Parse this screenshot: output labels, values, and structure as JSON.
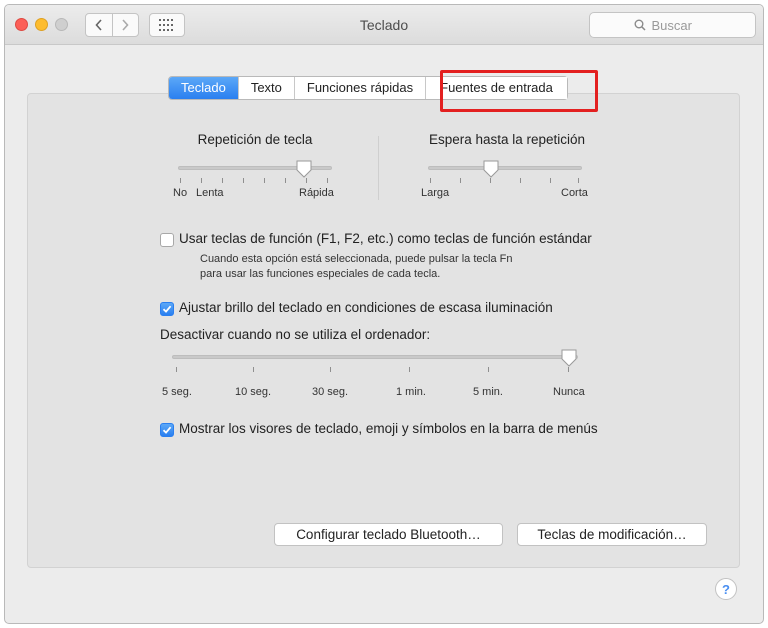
{
  "window": {
    "title": "Teclado",
    "search": {
      "placeholder": "Buscar",
      "value": ""
    }
  },
  "tabs": [
    {
      "label": "Teclado",
      "active": true
    },
    {
      "label": "Texto",
      "active": false
    },
    {
      "label": "Funciones rápidas",
      "active": false
    },
    {
      "label": "Fuentes de entrada",
      "active": false,
      "highlighted": true
    }
  ],
  "key_repeat": {
    "title": "Repetición de tecla",
    "labels": [
      "No",
      "Lenta",
      "Rápida"
    ],
    "level": 0.85
  },
  "delay_until_repeat": {
    "title": "Espera hasta la repetición",
    "labels": [
      "Larga",
      "Corta"
    ],
    "level": 0.4
  },
  "function_keys": {
    "label": "Usar teclas de función (F1, F2, etc.) como teclas de función estándar",
    "checked": false,
    "description_line1": "Cuando esta opción está seleccionada, puede pulsar la tecla Fn",
    "description_line2": "para usar las funciones especiales de cada tecla."
  },
  "brightness": {
    "label": "Ajustar brillo del teclado en condiciones de escasa iluminación",
    "checked": true
  },
  "deactivate": {
    "title": "Desactivar cuando no se utiliza el ordenador:",
    "labels": [
      "5 seg.",
      "10 seg.",
      "30 seg.",
      "1 min.",
      "5 min.",
      "Nunca"
    ],
    "selected": "Nunca"
  },
  "show_viewers": {
    "label": "Mostrar los visores de teclado, emoji y símbolos en la barra de menús",
    "checked": true
  },
  "buttons": {
    "bluetooth": "Configurar teclado Bluetooth…",
    "modifiers": "Teclas de modificación…"
  },
  "help": {
    "label": "?"
  },
  "colors": {
    "accent": "#2a7ff0",
    "highlight_border": "#e32020"
  }
}
